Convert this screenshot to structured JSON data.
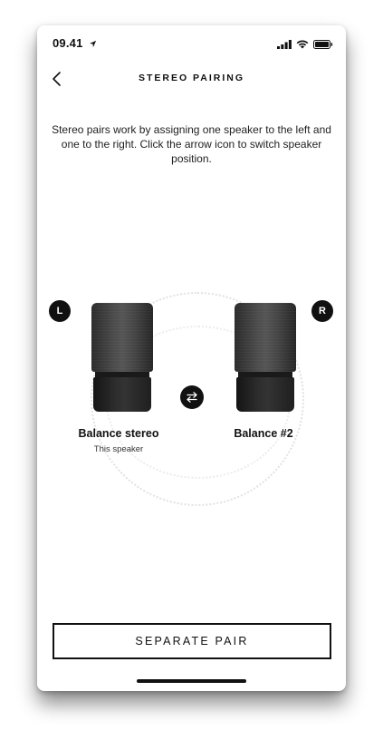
{
  "status_bar": {
    "time": "09.41",
    "icons": [
      "location-arrow-icon",
      "cellular-signal-icon",
      "wifi-icon",
      "battery-icon"
    ]
  },
  "header": {
    "back_icon": "chevron-left-icon",
    "title": "STEREO PAIRING"
  },
  "description": "Stereo pairs work by assigning one speaker to the left and one to the right. Click the arrow icon to switch speaker position.",
  "speakers": {
    "left": {
      "badge": "L",
      "name": "Balance stereo",
      "subtitle": "This speaker"
    },
    "right": {
      "badge": "R",
      "name": "Balance #2"
    },
    "swap_icon": "swap-arrows-icon"
  },
  "actions": {
    "separate_label": "SEPARATE PAIR"
  },
  "colors": {
    "primary": "#111111",
    "background": "#ffffff",
    "speaker_fabric": "#4a4a4a",
    "ring": "#e2e2e2"
  }
}
